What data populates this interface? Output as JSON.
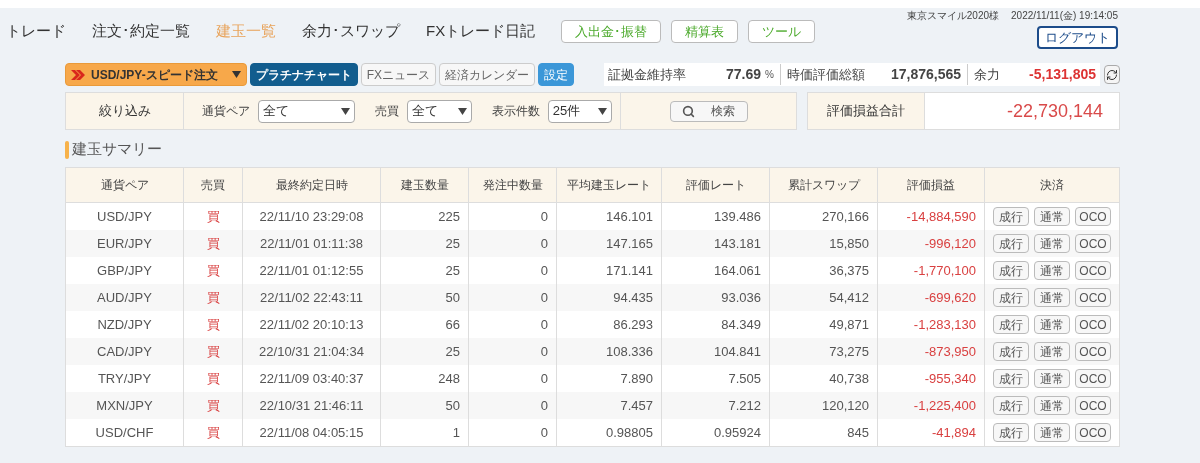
{
  "nav": [
    {
      "label": "トレード",
      "selected": false
    },
    {
      "label": "注文･約定一覧",
      "selected": false
    },
    {
      "label": "建玉一覧",
      "selected": true
    },
    {
      "label": "余力･スワップ",
      "selected": false
    },
    {
      "label": "FXトレード日記",
      "selected": false
    }
  ],
  "nav_buttons": [
    "入出金･振替",
    "精算表",
    "ツール"
  ],
  "user": "東京スマイル2020様",
  "datetime": "2022/11/11(金) 19:14:05",
  "logout": "ログアウト",
  "toolbar": [
    {
      "kind": "speed",
      "label": "USD/JPY-スピード注文"
    },
    {
      "kind": "primary",
      "label": "プラチナチャート"
    },
    {
      "kind": "plain",
      "label": "FXニュース"
    },
    {
      "kind": "plain",
      "label": "経済カレンダー"
    },
    {
      "kind": "accent",
      "label": "設定"
    }
  ],
  "stats": [
    {
      "label": "証拠金維持率",
      "value": "77.69",
      "unit": "%",
      "negative": false
    },
    {
      "label": "時価評価総額",
      "value": "17,876,565",
      "negative": false
    },
    {
      "label": "余力",
      "value": "-5,131,805",
      "negative": true
    }
  ],
  "filter": {
    "title": "絞り込み",
    "fields": [
      {
        "label": "通貨ペア",
        "value": "全て"
      },
      {
        "label": "売買",
        "value": "全て"
      },
      {
        "label": "表示件数",
        "value": "25件"
      }
    ],
    "search": "検索"
  },
  "total": {
    "label": "評価損益合計",
    "value": "-22,730,144"
  },
  "section_title": "建玉サマリー",
  "table": {
    "columns": [
      "通貨ペア",
      "売買",
      "最終約定日時",
      "建玉数量",
      "発注中数量",
      "平均建玉レート",
      "評価レート",
      "累計スワップ",
      "評価損益",
      "決済"
    ],
    "rows": [
      {
        "pair": "USD/JPY",
        "side": "買",
        "time": "22/11/10 23:29:08",
        "qty": "225",
        "pending": "0",
        "avg": "146.101",
        "rate": "139.486",
        "swap": "270,166",
        "pl": "-14,884,590",
        "actions": [
          "成行",
          "通常",
          "OCO"
        ]
      },
      {
        "pair": "EUR/JPY",
        "side": "買",
        "time": "22/11/01 01:11:38",
        "qty": "25",
        "pending": "0",
        "avg": "147.165",
        "rate": "143.181",
        "swap": "15,850",
        "pl": "-996,120",
        "actions": [
          "成行",
          "通常",
          "OCO"
        ]
      },
      {
        "pair": "GBP/JPY",
        "side": "買",
        "time": "22/11/01 01:12:55",
        "qty": "25",
        "pending": "0",
        "avg": "171.141",
        "rate": "164.061",
        "swap": "36,375",
        "pl": "-1,770,100",
        "actions": [
          "成行",
          "通常",
          "OCO"
        ]
      },
      {
        "pair": "AUD/JPY",
        "side": "買",
        "time": "22/11/02 22:43:11",
        "qty": "50",
        "pending": "0",
        "avg": "94.435",
        "rate": "93.036",
        "swap": "54,412",
        "pl": "-699,620",
        "actions": [
          "成行",
          "通常",
          "OCO"
        ]
      },
      {
        "pair": "NZD/JPY",
        "side": "買",
        "time": "22/11/02 20:10:13",
        "qty": "66",
        "pending": "0",
        "avg": "86.293",
        "rate": "84.349",
        "swap": "49,871",
        "pl": "-1,283,130",
        "actions": [
          "成行",
          "通常",
          "OCO"
        ]
      },
      {
        "pair": "CAD/JPY",
        "side": "買",
        "time": "22/10/31 21:04:34",
        "qty": "25",
        "pending": "0",
        "avg": "108.336",
        "rate": "104.841",
        "swap": "73,275",
        "pl": "-873,950",
        "actions": [
          "成行",
          "通常",
          "OCO"
        ]
      },
      {
        "pair": "TRY/JPY",
        "side": "買",
        "time": "22/11/09 03:40:37",
        "qty": "248",
        "pending": "0",
        "avg": "7.890",
        "rate": "7.505",
        "swap": "40,738",
        "pl": "-955,340",
        "actions": [
          "成行",
          "通常",
          "OCO"
        ]
      },
      {
        "pair": "MXN/JPY",
        "side": "買",
        "time": "22/10/31 21:46:11",
        "qty": "50",
        "pending": "0",
        "avg": "7.457",
        "rate": "7.212",
        "swap": "120,120",
        "pl": "-1,225,400",
        "actions": [
          "成行",
          "通常",
          "OCO"
        ]
      },
      {
        "pair": "USD/CHF",
        "side": "買",
        "time": "22/11/08 04:05:15",
        "qty": "1",
        "pending": "0",
        "avg": "0.98805",
        "rate": "0.95924",
        "swap": "845",
        "pl": "-41,894",
        "actions": [
          "成行",
          "通常",
          "OCO"
        ]
      }
    ]
  }
}
